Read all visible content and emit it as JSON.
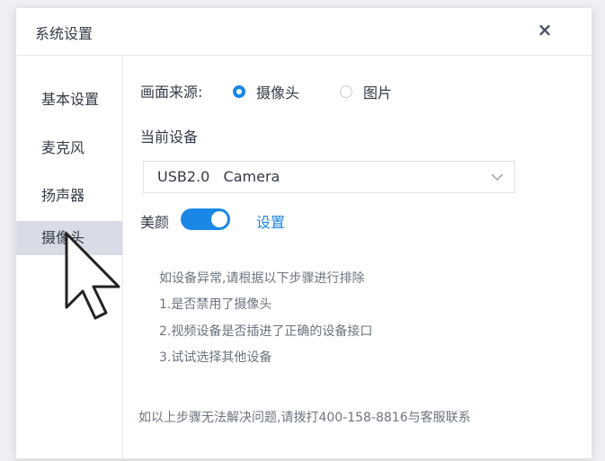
{
  "window": {
    "title": "系统设置",
    "close_glyph": "×"
  },
  "sidebar": {
    "items": [
      {
        "label": "基本设置",
        "active": false
      },
      {
        "label": "麦克风",
        "active": false
      },
      {
        "label": "扬声器",
        "active": false
      },
      {
        "label": "摄像头",
        "active": true
      }
    ]
  },
  "main": {
    "source_label": "画面来源:",
    "source_options": [
      {
        "label": "摄像头",
        "checked": true
      },
      {
        "label": "图片",
        "checked": false
      }
    ],
    "device_label": "当前设备",
    "device_value": "USB2.0   Camera",
    "beauty_label": "美颜",
    "beauty_on": true,
    "beauty_settings_link": "设置",
    "hints": [
      "如设备异常,请根据以下步骤进行排除",
      "1.是否禁用了摄像头",
      "2.视频设备是否插进了正确的设备接口",
      "3.试试选择其他设备"
    ],
    "footer": "如以上步骤无法解决问题,请拨打400-158-8816与客服联系"
  },
  "colors": {
    "accent": "#1a86e6",
    "active_bg": "#d8dce6",
    "text": "#333b47",
    "muted": "#6b7480"
  }
}
